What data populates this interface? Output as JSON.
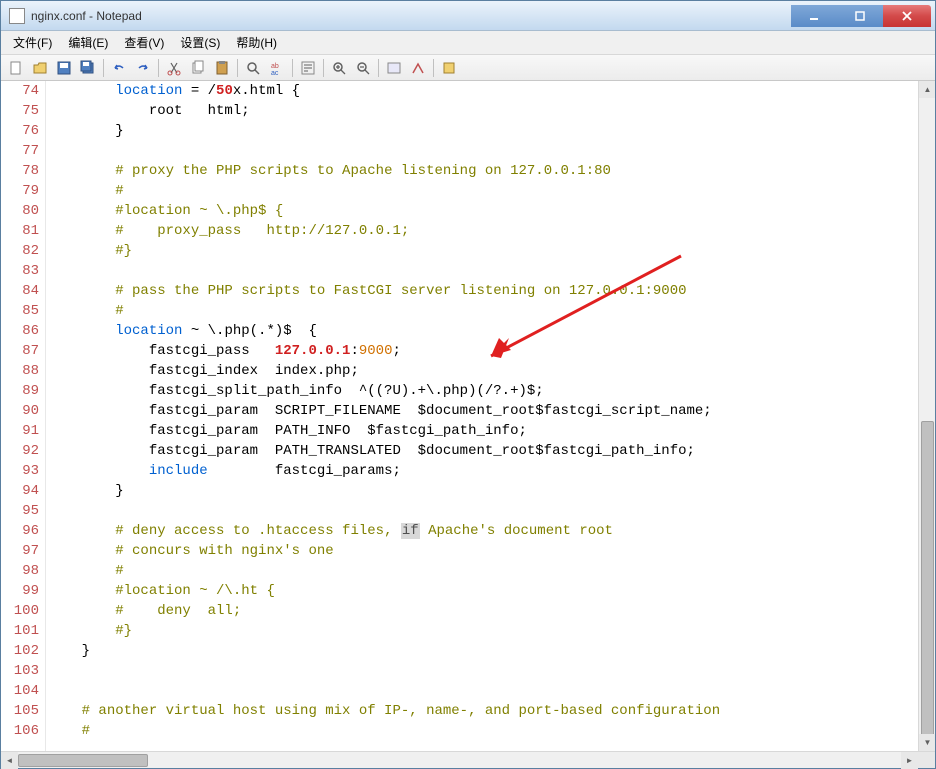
{
  "window": {
    "title": "nginx.conf - Notepad"
  },
  "menu": {
    "file": "文件(F)",
    "edit": "编辑(E)",
    "view": "查看(V)",
    "settings": "设置(S)",
    "help": "帮助(H)"
  },
  "gutter": {
    "start": 74,
    "end": 106
  },
  "code_lines": [
    {
      "n": 74,
      "segs": [
        {
          "t": "        "
        },
        {
          "t": "location",
          "c": "kw-blue"
        },
        {
          "t": " = /"
        },
        {
          "t": "50",
          "c": "kw-red"
        },
        {
          "t": "x.html {"
        }
      ]
    },
    {
      "n": 75,
      "segs": [
        {
          "t": "            root   html;"
        }
      ]
    },
    {
      "n": 76,
      "segs": [
        {
          "t": "        }"
        }
      ]
    },
    {
      "n": 77,
      "segs": [
        {
          "t": ""
        }
      ]
    },
    {
      "n": 78,
      "segs": [
        {
          "t": "        "
        },
        {
          "t": "# proxy the PHP scripts to Apache listening on 127.0.0.1:80",
          "c": "comment"
        }
      ]
    },
    {
      "n": 79,
      "segs": [
        {
          "t": "        "
        },
        {
          "t": "#",
          "c": "comment"
        }
      ]
    },
    {
      "n": 80,
      "segs": [
        {
          "t": "        "
        },
        {
          "t": "#location ~ \\.php$ {",
          "c": "comment"
        }
      ]
    },
    {
      "n": 81,
      "segs": [
        {
          "t": "        "
        },
        {
          "t": "#    proxy_pass   http://127.0.0.1;",
          "c": "comment"
        }
      ]
    },
    {
      "n": 82,
      "segs": [
        {
          "t": "        "
        },
        {
          "t": "#}",
          "c": "comment"
        }
      ]
    },
    {
      "n": 83,
      "segs": [
        {
          "t": ""
        }
      ]
    },
    {
      "n": 84,
      "segs": [
        {
          "t": "        "
        },
        {
          "t": "# pass the PHP scripts to FastCGI server listening on 127.0.0.1:9000",
          "c": "comment"
        }
      ]
    },
    {
      "n": 85,
      "segs": [
        {
          "t": "        "
        },
        {
          "t": "#",
          "c": "comment"
        }
      ]
    },
    {
      "n": 86,
      "segs": [
        {
          "t": "        "
        },
        {
          "t": "location",
          "c": "kw-blue"
        },
        {
          "t": " ~ \\.php(.*)$  {"
        }
      ]
    },
    {
      "n": 87,
      "segs": [
        {
          "t": "            fastcgi_pass   "
        },
        {
          "t": "127.0.0.1",
          "c": "kw-red"
        },
        {
          "t": ":"
        },
        {
          "t": "9000",
          "c": "kw-orange"
        },
        {
          "t": ";"
        }
      ]
    },
    {
      "n": 88,
      "segs": [
        {
          "t": "            fastcgi_index  index.php;"
        }
      ]
    },
    {
      "n": 89,
      "segs": [
        {
          "t": "            fastcgi_split_path_info  ^((?U).+\\.php)(/?.+)$;"
        }
      ]
    },
    {
      "n": 90,
      "segs": [
        {
          "t": "            fastcgi_param  SCRIPT_FILENAME  $document_root$fastcgi_script_name;"
        }
      ]
    },
    {
      "n": 91,
      "segs": [
        {
          "t": "            fastcgi_param  PATH_INFO  $fastcgi_path_info;"
        }
      ]
    },
    {
      "n": 92,
      "segs": [
        {
          "t": "            fastcgi_param  PATH_TRANSLATED  $document_root$fastcgi_path_info;"
        }
      ]
    },
    {
      "n": 93,
      "segs": [
        {
          "t": "            "
        },
        {
          "t": "include",
          "c": "kw-blue"
        },
        {
          "t": "        fastcgi_params;"
        }
      ]
    },
    {
      "n": 94,
      "segs": [
        {
          "t": "        }"
        }
      ]
    },
    {
      "n": 95,
      "segs": [
        {
          "t": ""
        }
      ]
    },
    {
      "n": 96,
      "segs": [
        {
          "t": "        "
        },
        {
          "t": "# deny access to .htaccess files, ",
          "c": "comment"
        },
        {
          "t": "if",
          "c": "kw-highlight"
        },
        {
          "t": " Apache's document root",
          "c": "comment"
        }
      ]
    },
    {
      "n": 97,
      "segs": [
        {
          "t": "        "
        },
        {
          "t": "# concurs with nginx's one",
          "c": "comment"
        }
      ]
    },
    {
      "n": 98,
      "segs": [
        {
          "t": "        "
        },
        {
          "t": "#",
          "c": "comment"
        }
      ]
    },
    {
      "n": 99,
      "segs": [
        {
          "t": "        "
        },
        {
          "t": "#location ~ /\\.ht {",
          "c": "comment"
        }
      ]
    },
    {
      "n": 100,
      "segs": [
        {
          "t": "        "
        },
        {
          "t": "#    deny  all;",
          "c": "comment"
        }
      ]
    },
    {
      "n": 101,
      "segs": [
        {
          "t": "        "
        },
        {
          "t": "#}",
          "c": "comment"
        }
      ]
    },
    {
      "n": 102,
      "segs": [
        {
          "t": "    }"
        }
      ]
    },
    {
      "n": 103,
      "segs": [
        {
          "t": ""
        }
      ]
    },
    {
      "n": 104,
      "segs": [
        {
          "t": ""
        }
      ]
    },
    {
      "n": 105,
      "segs": [
        {
          "t": "    "
        },
        {
          "t": "# another virtual host using mix of IP-, name-, and port-based configuration",
          "c": "comment"
        }
      ]
    },
    {
      "n": 106,
      "segs": [
        {
          "t": "    "
        },
        {
          "t": "#",
          "c": "comment"
        }
      ]
    }
  ]
}
